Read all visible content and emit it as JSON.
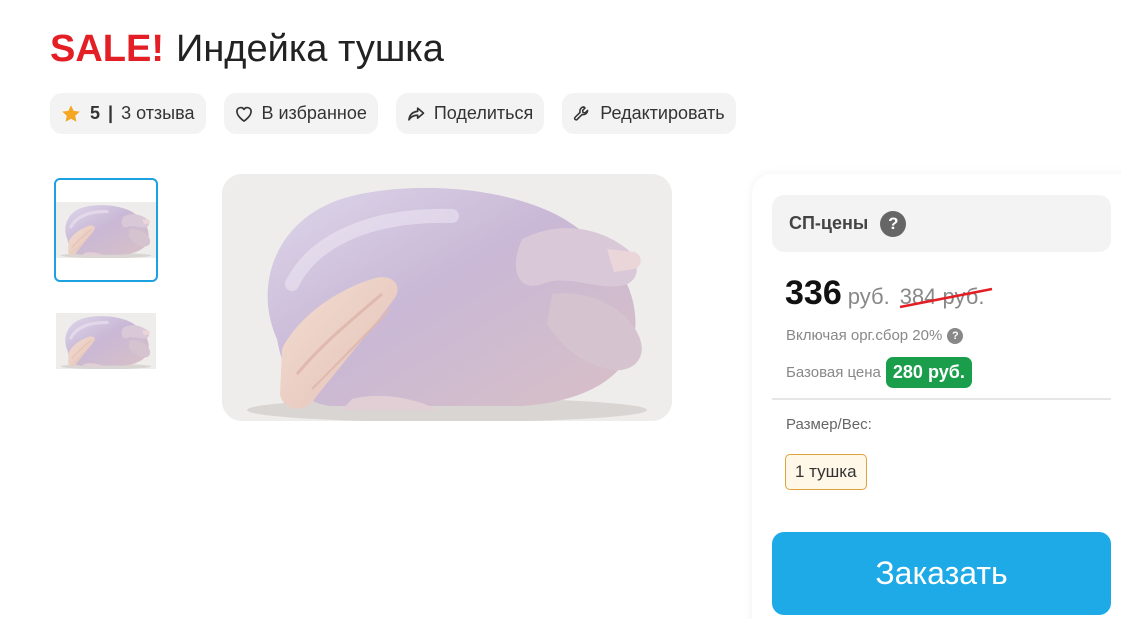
{
  "product": {
    "sale_label": "SALE!",
    "title": "Индейка тушка"
  },
  "actions": {
    "rating_value": "5",
    "rating_separator": "|",
    "reviews_label": "3 отзыва",
    "favorite_label": "В избранное",
    "share_label": "Поделиться",
    "edit_label": "Редактировать"
  },
  "gallery": {
    "thumbnail_count": 2,
    "active_thumbnail": 1
  },
  "pricing": {
    "sp_prices_label": "СП-цены",
    "help_symbol": "?",
    "price": "336",
    "currency": "руб.",
    "old_price": "384 руб.",
    "fee_text": "Включая орг.сбор 20%",
    "base_price_label": "Базовая цена",
    "base_price_value": "280 руб."
  },
  "options": {
    "size_label": "Размер/Вес:",
    "selected_size": "1 тушка"
  },
  "order_button_label": "Заказать",
  "colors": {
    "sale_red": "#e31e24",
    "accent_blue": "#1eaae6",
    "green_badge": "#1a9e4b",
    "star_orange": "#f5a623",
    "option_border": "#e0a23a"
  },
  "icons": [
    "star-icon",
    "heart-icon",
    "share-icon",
    "wrench-icon",
    "help-icon"
  ]
}
